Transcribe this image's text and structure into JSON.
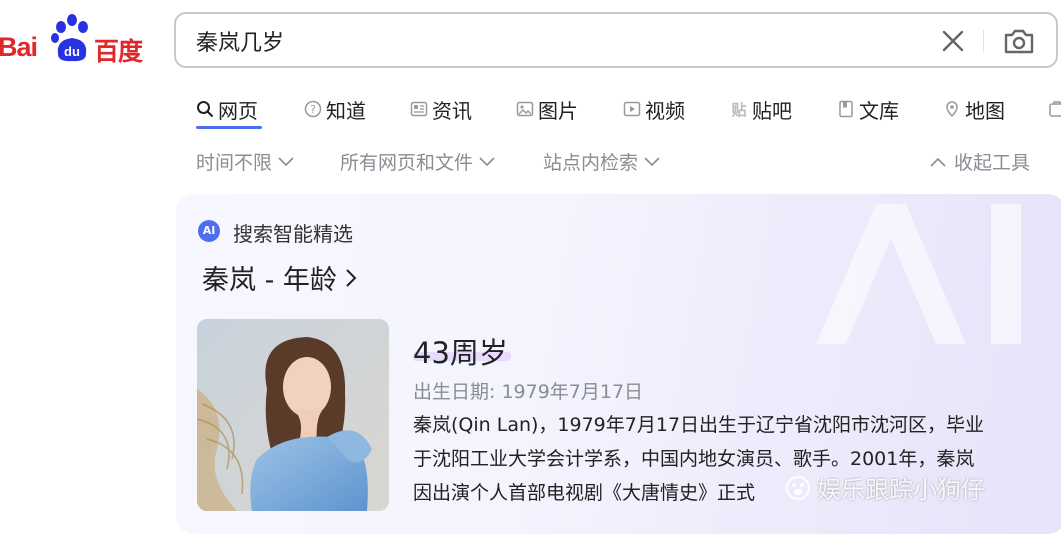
{
  "logo": {
    "text_latin": "Bai",
    "paw_text": "du",
    "text_cn": "百度"
  },
  "search": {
    "query": "秦岚几岁"
  },
  "tabs": [
    {
      "label": "网页",
      "icon": "search-icon"
    },
    {
      "label": "知道",
      "icon": "question-icon"
    },
    {
      "label": "资讯",
      "icon": "news-icon"
    },
    {
      "label": "图片",
      "icon": "image-icon"
    },
    {
      "label": "视频",
      "icon": "video-icon"
    },
    {
      "label": "贴吧",
      "icon": "tieba-icon"
    },
    {
      "label": "文库",
      "icon": "document-icon"
    },
    {
      "label": "地图",
      "icon": "map-icon"
    }
  ],
  "filters": {
    "time": "时间不限",
    "scope": "所有网页和文件",
    "site": "站点内检索",
    "collapse": "收起工具"
  },
  "ai_card": {
    "badge": "AI",
    "label": "搜索智能精选",
    "title": "秦岚 - 年龄",
    "age": "43周岁",
    "birth": "出生日期: 1979年7月17日",
    "bio_lines": [
      "秦岚(Qin Lan)，1979年7月17日出生于辽宁省沈阳市沈河区，毕业",
      "于沈阳工业大学会计学系，中国内地女演员、歌手。2001年，秦岚",
      "因出演个人首部电视剧《大唐情史》正式"
    ]
  },
  "watermark": {
    "text": "娱乐跟踪小狗仔"
  },
  "colors": {
    "brand_red": "#e2262a",
    "brand_blue": "#4e6ef2",
    "muted": "#8a8d94"
  }
}
